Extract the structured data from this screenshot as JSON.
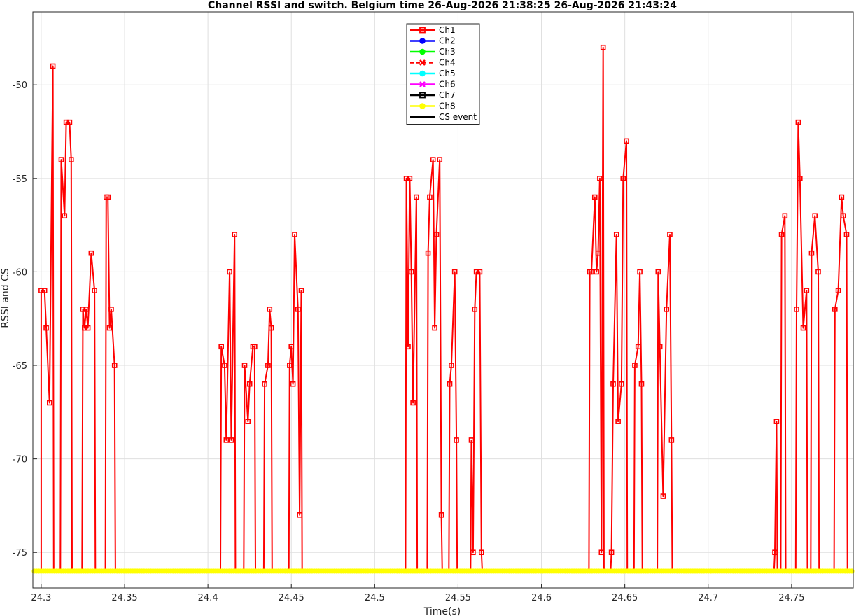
{
  "chart_data": {
    "type": "line",
    "title": "Channel RSSI and switch. Belgium time 26-Aug-2026 21:38:25 26-Aug-2026 21:43:24",
    "xlabel": "Time(s)",
    "ylabel": "RSSI and CS",
    "xlim": [
      24.295,
      24.787
    ],
    "ylim": [
      -76.9,
      -46.1
    ],
    "xticks": [
      24.3,
      24.35,
      24.4,
      24.45,
      24.5,
      24.55,
      24.6,
      24.65,
      24.7,
      24.75
    ],
    "xtick_labels": [
      "24.3",
      "24.35",
      "24.4",
      "24.45",
      "24.5",
      "24.55",
      "24.6",
      "24.65",
      "24.7",
      "24.75"
    ],
    "yticks": [
      -75,
      -70,
      -65,
      -60,
      -55,
      -50
    ],
    "ytick_labels": [
      "-75",
      "-70",
      "-65",
      "-60",
      "-55",
      "-50"
    ],
    "grid": true,
    "legend_position": "top-center",
    "baseline": -76,
    "series": [
      {
        "name": "Ch1",
        "color": "#ff0000",
        "marker": "square",
        "line_style": "solid",
        "peaks": [
          [
            24.3,
            -61
          ],
          [
            24.302,
            -61
          ],
          [
            24.303,
            -63
          ],
          [
            24.305,
            -67
          ],
          [
            24.307,
            -49
          ],
          [
            24.312,
            -54
          ],
          [
            24.314,
            -57
          ],
          [
            24.315,
            -52
          ],
          [
            24.317,
            -52
          ],
          [
            24.318,
            -54
          ],
          [
            24.325,
            -62
          ],
          [
            24.326,
            -63
          ],
          [
            24.327,
            -62
          ],
          [
            24.328,
            -63
          ],
          [
            24.33,
            -59
          ],
          [
            24.332,
            -61
          ],
          [
            24.339,
            -56
          ],
          [
            24.34,
            -56
          ],
          [
            24.341,
            -63
          ],
          [
            24.342,
            -62
          ],
          [
            24.344,
            -65
          ],
          [
            24.408,
            -64
          ],
          [
            24.41,
            -65
          ],
          [
            24.411,
            -69
          ],
          [
            24.413,
            -60
          ],
          [
            24.414,
            -69
          ],
          [
            24.416,
            -58
          ],
          [
            24.422,
            -65
          ],
          [
            24.424,
            -68
          ],
          [
            24.425,
            -66
          ],
          [
            24.427,
            -64
          ],
          [
            24.428,
            -64
          ],
          [
            24.434,
            -66
          ],
          [
            24.436,
            -65
          ],
          [
            24.437,
            -62
          ],
          [
            24.438,
            -63
          ],
          [
            24.449,
            -65
          ],
          [
            24.45,
            -64
          ],
          [
            24.451,
            -66
          ],
          [
            24.452,
            -58
          ],
          [
            24.454,
            -62
          ],
          [
            24.455,
            -73
          ],
          [
            24.456,
            -61
          ],
          [
            24.519,
            -55
          ],
          [
            24.52,
            -64
          ],
          [
            24.521,
            -55
          ],
          [
            24.522,
            -60
          ],
          [
            24.523,
            -67
          ],
          [
            24.525,
            -56
          ],
          [
            24.532,
            -59
          ],
          [
            24.533,
            -56
          ],
          [
            24.535,
            -54
          ],
          [
            24.536,
            -63
          ],
          [
            24.537,
            -58
          ],
          [
            24.539,
            -54
          ],
          [
            24.54,
            -73
          ],
          [
            24.545,
            -66
          ],
          [
            24.546,
            -65
          ],
          [
            24.548,
            -60
          ],
          [
            24.549,
            -69
          ],
          [
            24.558,
            -69
          ],
          [
            24.559,
            -75
          ],
          [
            24.56,
            -62
          ],
          [
            24.561,
            -60
          ],
          [
            24.563,
            -60
          ],
          [
            24.564,
            -75
          ],
          [
            24.629,
            -60
          ],
          [
            24.63,
            -60
          ],
          [
            24.632,
            -56
          ],
          [
            24.633,
            -60
          ],
          [
            24.634,
            -59
          ],
          [
            24.635,
            -55
          ],
          [
            24.636,
            -75
          ],
          [
            24.637,
            -48
          ],
          [
            24.642,
            -75
          ],
          [
            24.643,
            -66
          ],
          [
            24.645,
            -58
          ],
          [
            24.646,
            -68
          ],
          [
            24.648,
            -66
          ],
          [
            24.649,
            -55
          ],
          [
            24.651,
            -53
          ],
          [
            24.656,
            -65
          ],
          [
            24.658,
            -64
          ],
          [
            24.659,
            -60
          ],
          [
            24.66,
            -66
          ],
          [
            24.67,
            -60
          ],
          [
            24.671,
            -64
          ],
          [
            24.673,
            -72
          ],
          [
            24.675,
            -62
          ],
          [
            24.677,
            -58
          ],
          [
            24.678,
            -69
          ],
          [
            24.74,
            -75
          ],
          [
            24.741,
            -68
          ],
          [
            24.744,
            -58
          ],
          [
            24.746,
            -57
          ],
          [
            24.753,
            -62
          ],
          [
            24.754,
            -52
          ],
          [
            24.755,
            -55
          ],
          [
            24.757,
            -63
          ],
          [
            24.759,
            -61
          ],
          [
            24.762,
            -59
          ],
          [
            24.764,
            -57
          ],
          [
            24.766,
            -60
          ],
          [
            24.776,
            -62
          ],
          [
            24.778,
            -61
          ],
          [
            24.78,
            -56
          ],
          [
            24.781,
            -57
          ],
          [
            24.783,
            -58
          ]
        ]
      },
      {
        "name": "Ch2",
        "color": "#0000ff",
        "marker": "circle",
        "line_style": "solid"
      },
      {
        "name": "Ch3",
        "color": "#00ff00",
        "marker": "circle",
        "line_style": "solid"
      },
      {
        "name": "Ch4",
        "color": "#ff0000",
        "marker": "x",
        "line_style": "dashed"
      },
      {
        "name": "Ch5",
        "color": "#00ffff",
        "marker": "circle",
        "line_style": "solid"
      },
      {
        "name": "Ch6",
        "color": "#ff00ff",
        "marker": "x",
        "line_style": "solid"
      },
      {
        "name": "Ch7",
        "color": "#000000",
        "marker": "square",
        "line_style": "solid"
      },
      {
        "name": "Ch8",
        "color": "#ffff00",
        "marker": "circle",
        "line_style": "solid",
        "constant_value": -76
      },
      {
        "name": "CS event",
        "color": "#000000",
        "marker": "none",
        "line_style": "solid"
      }
    ]
  }
}
